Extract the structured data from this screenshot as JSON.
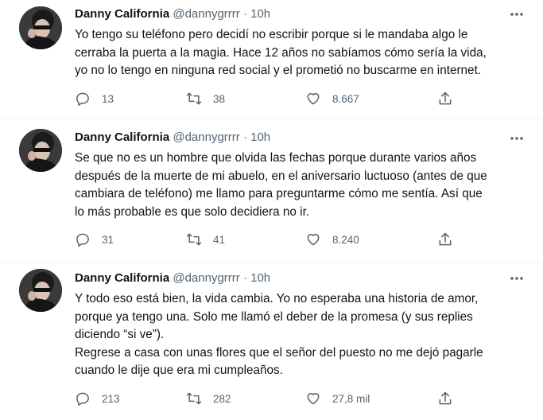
{
  "tweets": [
    {
      "name": "Danny California",
      "handle": "@dannygrrrr",
      "sep": "·",
      "time": "10h",
      "text": "Yo tengo su teléfono pero decidí no escribir porque si le mandaba algo le\ncerraba la puerta a la magia. Hace 12 años no sabíamos cómo sería la vida,\nyo no lo tengo en ninguna red social y el prometió no buscarme en internet.",
      "replies": "13",
      "retweets": "38",
      "likes": "8.667"
    },
    {
      "name": "Danny California",
      "handle": "@dannygrrrr",
      "sep": "·",
      "time": "10h",
      "text": "Se que no es un hombre que olvida las fechas porque durante varios años\ndespués de la muerte de mi abuelo, en el aniversario luctuoso (antes de que\ncambiara de teléfono) me llamo para preguntarme cómo me sentía. Así que\nlo más probable es que solo decidiera no ir.",
      "replies": "31",
      "retweets": "41",
      "likes": "8.240"
    },
    {
      "name": "Danny California",
      "handle": "@dannygrrrr",
      "sep": "·",
      "time": "10h",
      "text": "Y todo eso está bien, la vida cambia. Yo no esperaba una historia de amor,\nporque ya tengo una. Solo me llamó el deber de la promesa (y sus replies\ndiciendo “si ve”).\nRegrese a casa con unas flores que el señor del puesto no me dejó pagarle\ncuando le dije que era mi cumpleaños.",
      "replies": "213",
      "retweets": "282",
      "likes": "27,8 mil"
    }
  ],
  "icons": {
    "reply": "reply-icon",
    "retweet": "retweet-icon",
    "like": "heart-icon",
    "share": "share-icon",
    "more": "more-icon"
  },
  "colors": {
    "text": "#0f1419",
    "secondary": "#536471",
    "divider": "#eff3f4"
  }
}
